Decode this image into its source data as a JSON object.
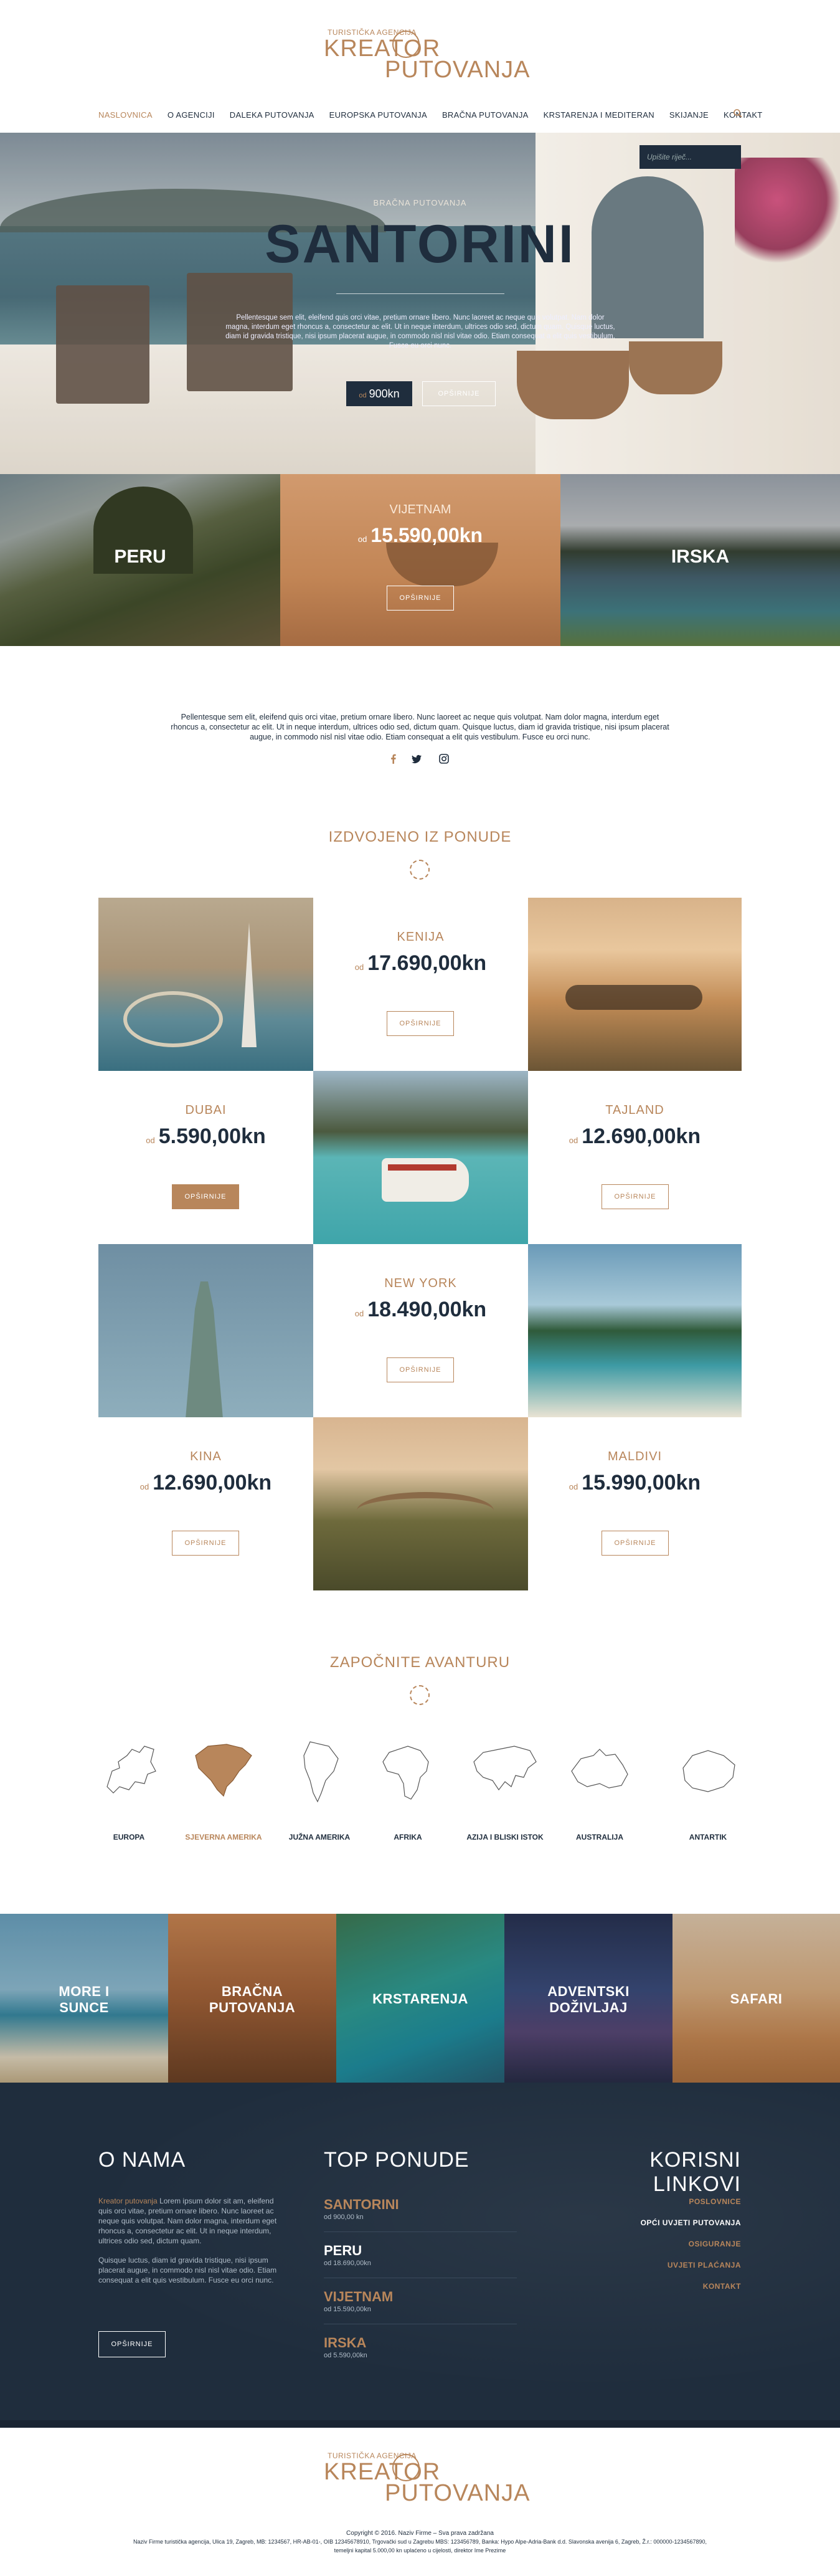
{
  "header": {
    "logo_small": "TURISTIČKA AGENCIJA",
    "logo_line1": "KREATOR",
    "logo_line2": "PUTOVANJA"
  },
  "nav": {
    "items": [
      {
        "label": "NASLOVNICA",
        "active": true
      },
      {
        "label": "O AGENCIJI",
        "active": false
      },
      {
        "label": "DALEKA PUTOVANJA",
        "active": false
      },
      {
        "label": "EUROPSKA PUTOVANJA",
        "active": false
      },
      {
        "label": "BRAČNA PUTOVANJA",
        "active": false
      },
      {
        "label": "KRSTARENJA I MEDITERAN",
        "active": false
      },
      {
        "label": "SKIJANJE",
        "active": false
      },
      {
        "label": "KONTAKT",
        "active": false
      }
    ],
    "search_icon": "search-icon"
  },
  "hero": {
    "search_placeholder": "Upišite riječ...",
    "kicker": "BRAČNA PUTOVANJA",
    "title": "SANTORINI",
    "text": "Pellentesque sem elit, eleifend quis orci vitae, pretium ornare libero. Nunc laoreet ac neque quis volutpat. Nam dolor magna, interdum eget rhoncus a, consectetur ac elit. Ut in neque interdum, ultrices odio sed, dictum quam. Quisque luctus, diam id gravida tristique, nisi ipsum placerat augue, in commodo nisl nisl vitae odio. Etiam consequat a elit quis vestibulum. Fusce eu orci nunc.",
    "price_prefix": "od",
    "price": "900kn",
    "more_label": "OPŠIRNIJE"
  },
  "tiles": [
    {
      "label": "PERU"
    },
    {
      "city": "VIJETNAM",
      "price_prefix": "od",
      "price": "15.590,00kn",
      "button": "OPŠIRNIJE"
    },
    {
      "label": "IRSKA"
    }
  ],
  "intro": {
    "text": "Pellentesque sem elit, eleifend quis orci vitae, pretium ornare libero. Nunc laoreet ac neque quis volutpat. Nam dolor magna, interdum eget rhoncus a, consectetur ac elit. Ut in neque interdum, ultrices odio sed, dictum quam. Quisque luctus, diam id gravida tristique, nisi ipsum placerat augue, in commodo nisl nisl vitae odio. Etiam consequat a elit quis vestibulum. Fusce eu orci nunc.",
    "social": [
      "facebook-icon",
      "twitter-icon",
      "instagram-icon"
    ]
  },
  "offers": {
    "heading": "IZDVOJENO IZ PONUDE",
    "items": [
      {
        "city": "KENIJA",
        "price_prefix": "od",
        "price": "17.690,00kn",
        "button": "OPŠIRNIJE"
      },
      {
        "city": "DUBAI",
        "price_prefix": "od",
        "price": "5.590,00kn",
        "button": "OPŠIRNIJE"
      },
      {
        "city": "TAJLAND",
        "price_prefix": "od",
        "price": "12.690,00kn",
        "button": "OPŠIRNIJE"
      },
      {
        "city": "NEW YORK",
        "price_prefix": "od",
        "price": "18.490,00kn",
        "button": "OPŠIRNIJE"
      },
      {
        "city": "KINA",
        "price_prefix": "od",
        "price": "12.690,00kn",
        "button": "OPŠIRNIJE"
      },
      {
        "city": "MALDIVI",
        "price_prefix": "od",
        "price": "15.990,00kn",
        "button": "OPŠIRNIJE"
      }
    ]
  },
  "adventure": {
    "heading": "ZAPOČNITE AVANTURU",
    "continents": [
      {
        "label": "EUROPA",
        "active": false
      },
      {
        "label": "SJEVERNA AMERIKA",
        "active": true
      },
      {
        "label": "JUŽNA AMERIKA",
        "active": false
      },
      {
        "label": "AFRIKA",
        "active": false
      },
      {
        "label": "AZIJA I BLISKI ISTOK",
        "active": false
      },
      {
        "label": "AUSTRALIJA",
        "active": false
      },
      {
        "label": "ANTARTIK",
        "active": false
      }
    ]
  },
  "categories": [
    {
      "label": "MORE I SUNCE"
    },
    {
      "label": "BRAČNA PUTOVANJA"
    },
    {
      "label": "KRSTARENJA"
    },
    {
      "label": "ADVENTSKI DOŽIVLJAJ"
    },
    {
      "label": "SAFARI"
    }
  ],
  "footer": {
    "about_heading": "O NAMA",
    "about_brand": "Kreator putovanja",
    "about_p1": "Lorem ipsum dolor sit am, eleifend quis orci vitae, pretium ornare libero. Nunc laoreet ac neque quis volutpat. Nam dolor magna, interdum eget rhoncus a, consectetur ac elit. Ut in neque interdum, ultrices odio sed, dictum quam.",
    "about_p2": "Quisque luctus, diam id gravida tristique, nisi ipsum placerat augue, in commodo nisl nisl vitae odio. Etiam consequat a elit quis vestibulum. Fusce eu orci nunc.",
    "about_button": "OPŠIRNIJE",
    "top_heading": "TOP PONUDE",
    "top_items": [
      {
        "name": "SANTORINI",
        "sub": "od 900,00 kn"
      },
      {
        "name": "PERU",
        "sub": "od 18.690,00kn"
      },
      {
        "name": "VIJETNAM",
        "sub": "od 15.590,00kn"
      },
      {
        "name": "IRSKA",
        "sub": "od 5.590,00kn"
      }
    ],
    "links_heading": "KORISNI LINKOVI",
    "links": [
      {
        "label": "POSLOVNICE",
        "active": false
      },
      {
        "label": "OPĆI UVJETI PUTOVANJA",
        "active": true
      },
      {
        "label": "OSIGURANJE",
        "active": false
      },
      {
        "label": "UVJETI PLAĆANJA",
        "active": false
      },
      {
        "label": "KONTAKT",
        "active": false
      }
    ]
  },
  "bottom": {
    "logo_small": "TURISTIČKA AGENCIJA",
    "logo_line1": "KREATOR",
    "logo_line2": "PUTOVANJA",
    "copyright": "Copyright © 2016. Naziv Firme – Sva prava zadržana",
    "legal1": "Naziv Firme turistička agencija, Ulica 19, Zagreb, MB: 1234567, HR-AB-01-, OIB 12345678910, Trgovački sud u Zagrebu MBS: 123456789, Banka: Hypo Alpe-Adria-Bank d.d. Slavonska avenija 6, Zagreb, Ž.r.: 000000-1234567890,",
    "legal2": "temeljni kapital 5.000,00 kn uplaćeno u cijelosti, direktor Ime Prezime"
  }
}
